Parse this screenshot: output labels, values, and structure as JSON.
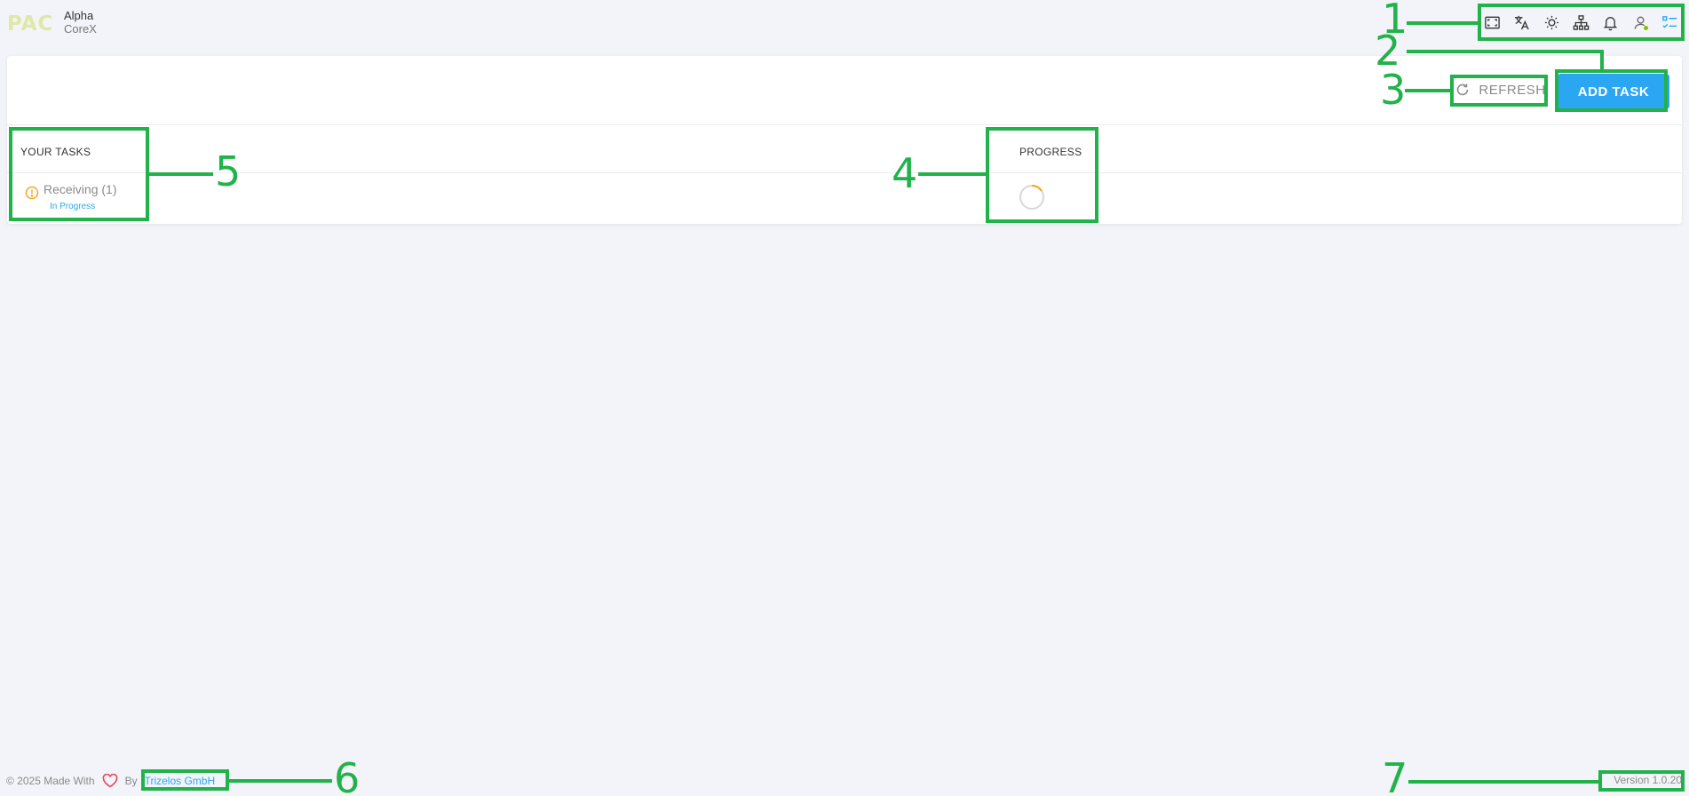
{
  "header": {
    "logo_text": "PAC",
    "brand_line1": "Alpha",
    "brand_line2": "CoreX",
    "icons": [
      "fullscreen-icon",
      "translate-icon",
      "brightness-icon",
      "sitemap-icon",
      "bell-icon",
      "user-icon",
      "tasklist-icon"
    ],
    "online_color": "#88c100"
  },
  "toolbar": {
    "refresh_label": "REFRESH",
    "add_task_label": "ADD TASK",
    "accent_color": "#2ba6f3"
  },
  "table": {
    "col_tasks": "YOUR TASKS",
    "col_progress": "PROGRESS",
    "tasks": [
      {
        "name": "Receiving (1)",
        "status": "In Progress",
        "icon": "warning-circle-icon",
        "icon_color": "#f5a623"
      }
    ]
  },
  "footer": {
    "made_with": "© 2025 Made With",
    "by": "By",
    "company": "Trizelos GmbH",
    "version": "Version 1.0.20"
  },
  "annotations": [
    "1",
    "2",
    "3",
    "4",
    "5",
    "6",
    "7"
  ],
  "annotation_color": "#21b24a"
}
